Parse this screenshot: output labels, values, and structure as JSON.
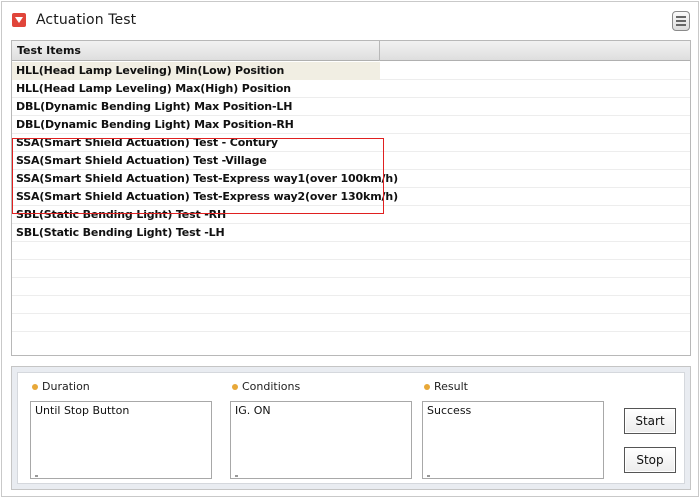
{
  "window": {
    "title": "Actuation Test",
    "title_icon": "red-dropdown-icon",
    "menu_icon": "list-menu-icon"
  },
  "table": {
    "columns": [
      "Test Items",
      ""
    ],
    "rows": [
      "HLL(Head Lamp Leveling) Min(Low) Position",
      "HLL(Head Lamp Leveling) Max(High) Position",
      "DBL(Dynamic Bending Light) Max Position-LH",
      "DBL(Dynamic Bending Light) Max Position-RH",
      "SSA(Smart Shield Actuation) Test - Contury",
      "SSA(Smart Shield Actuation) Test -Village",
      "SSA(Smart Shield Actuation) Test-Express way1(over 100km/h)",
      "SSA(Smart Shield Actuation) Test-Express way2(over 130km/h)",
      "SBL(Static Bending Light) Test -RH",
      "SBL(Static Bending Light) Test -LH",
      "",
      "",
      "",
      "",
      ""
    ],
    "selected_index": 0,
    "highlight_color": "#e02020"
  },
  "details": {
    "duration": {
      "label": "Duration",
      "value": "Until Stop Button"
    },
    "conditions": {
      "label": "Conditions",
      "value": "IG. ON"
    },
    "result": {
      "label": "Result",
      "value": "Success"
    }
  },
  "buttons": {
    "start": "Start",
    "stop": "Stop"
  },
  "colors": {
    "accent": "#e0453a",
    "bullet": "#e8a838",
    "panel_bg": "#e9ecf1"
  }
}
